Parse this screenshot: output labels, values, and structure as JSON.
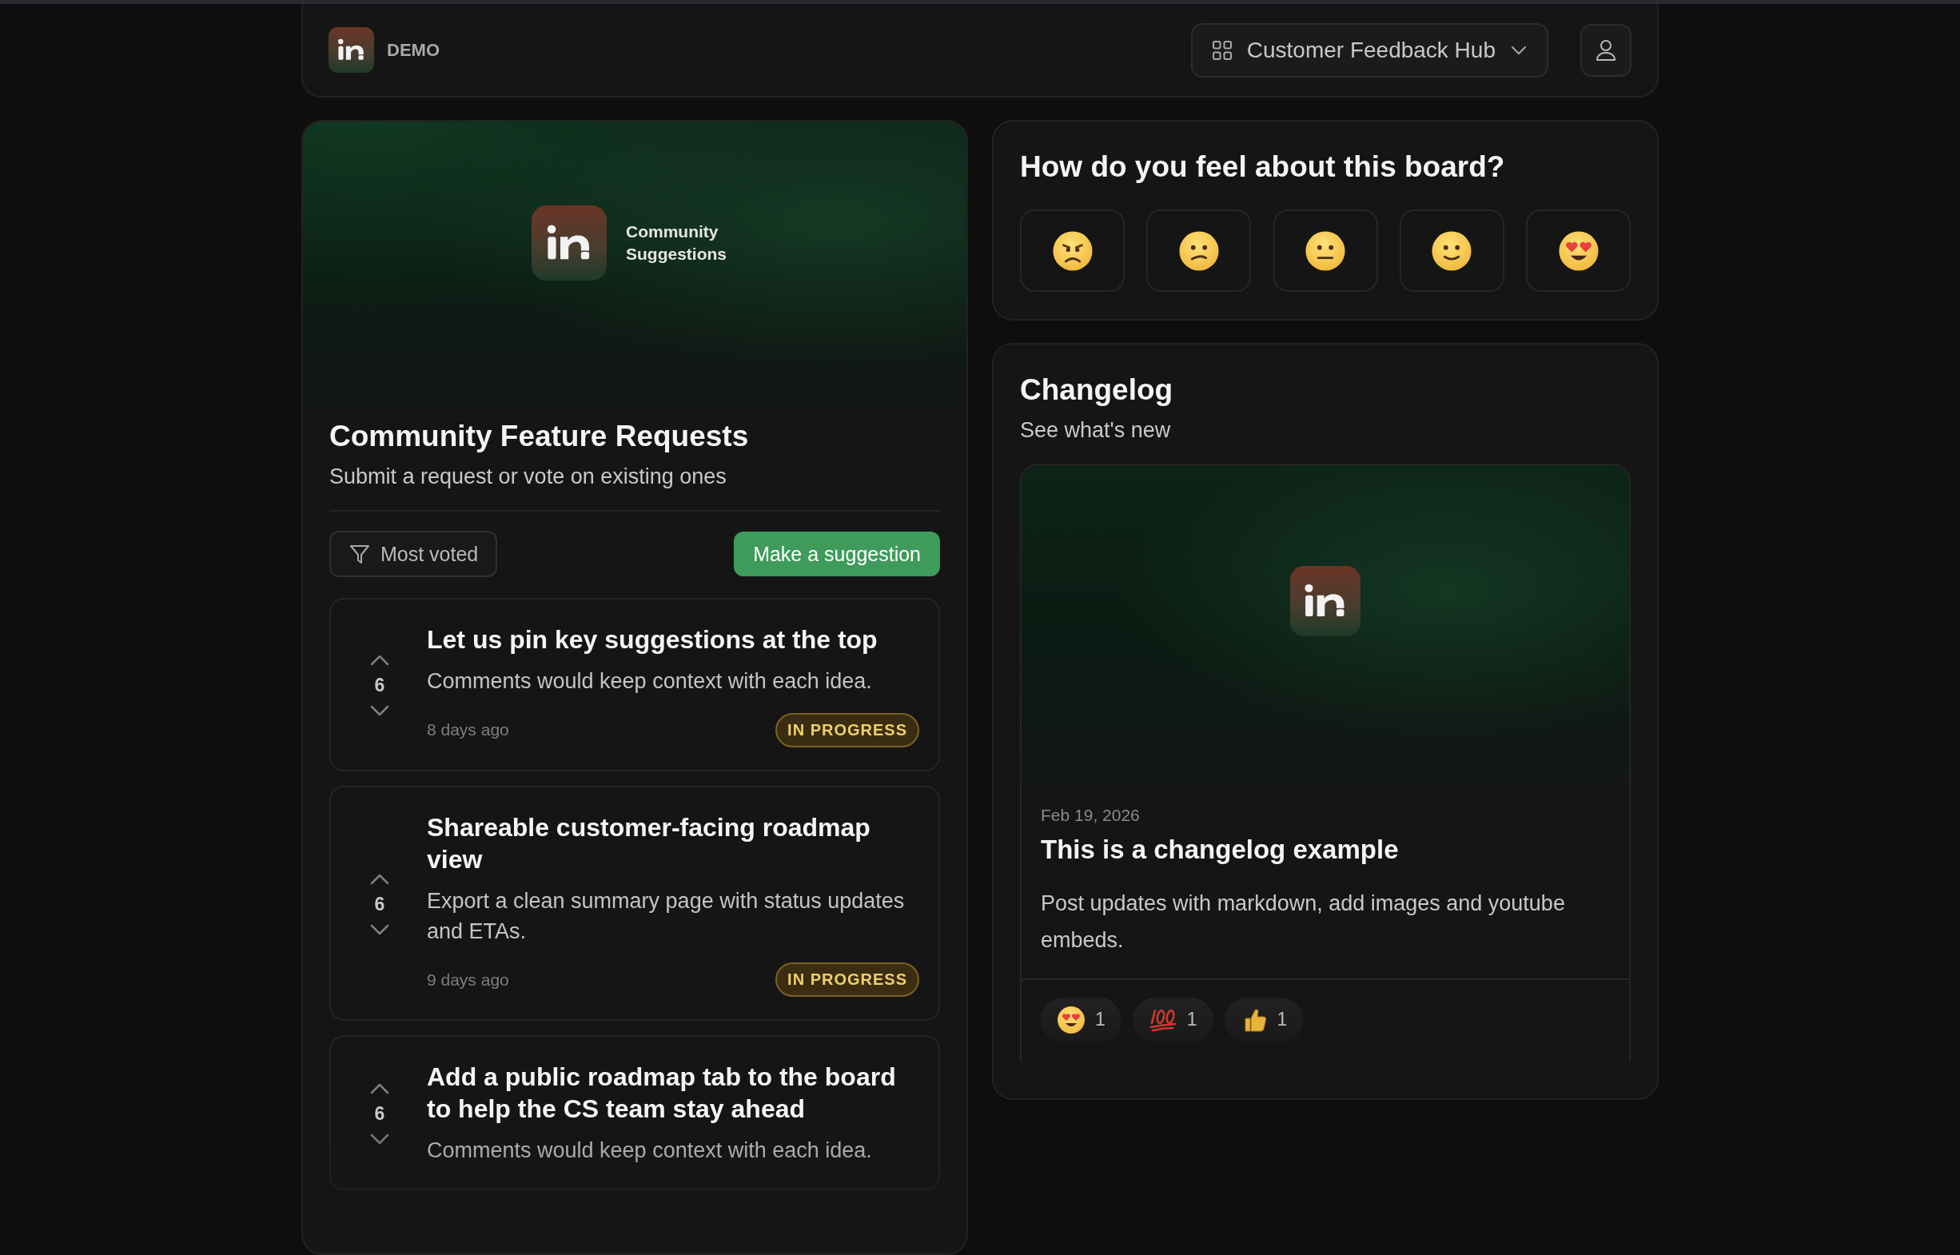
{
  "header": {
    "brand": "DEMO",
    "board_selector": {
      "label": "Customer Feedback Hub"
    }
  },
  "board": {
    "banner": {
      "caption": "Community Suggestions"
    },
    "title": "Community Feature Requests",
    "subtitle": "Submit a request or vote on existing ones",
    "sort": {
      "label": "Most voted"
    },
    "primary_action": "Make a suggestion",
    "suggestions": [
      {
        "title": "Let us pin key suggestions at the top",
        "description": "Comments would keep context with each idea.",
        "votes": "6",
        "age": "8 days ago",
        "status": {
          "label": "IN PROGRESS",
          "kind": "in_progress"
        }
      },
      {
        "title": "Shareable customer-facing roadmap view",
        "description": "Export a clean summary page with status updates and ETAs.",
        "votes": "6",
        "age": "9 days ago",
        "status": {
          "label": "IN PROGRESS",
          "kind": "in_progress"
        }
      },
      {
        "title": "Add a public roadmap tab to the board to help the CS team stay ahead",
        "description": "Comments would keep context with each idea.",
        "votes": "6"
      }
    ]
  },
  "feedback": {
    "question": "How do you feel about this board?",
    "options": [
      {
        "kind": "angry"
      },
      {
        "kind": "confused"
      },
      {
        "kind": "neutral"
      },
      {
        "kind": "slight_smile"
      },
      {
        "kind": "heart_eyes"
      }
    ]
  },
  "changelog": {
    "title": "Changelog",
    "subtitle": "See what's new",
    "entries": [
      {
        "date": "Feb 19, 2026",
        "title": "This is a changelog example",
        "body": "Post updates with markdown, add images and youtube embeds.",
        "reactions": [
          {
            "kind": "heart_eyes",
            "count": "1"
          },
          {
            "kind": "hundred",
            "count": "1"
          },
          {
            "kind": "thumbs_up",
            "count": "1"
          }
        ]
      }
    ]
  }
}
